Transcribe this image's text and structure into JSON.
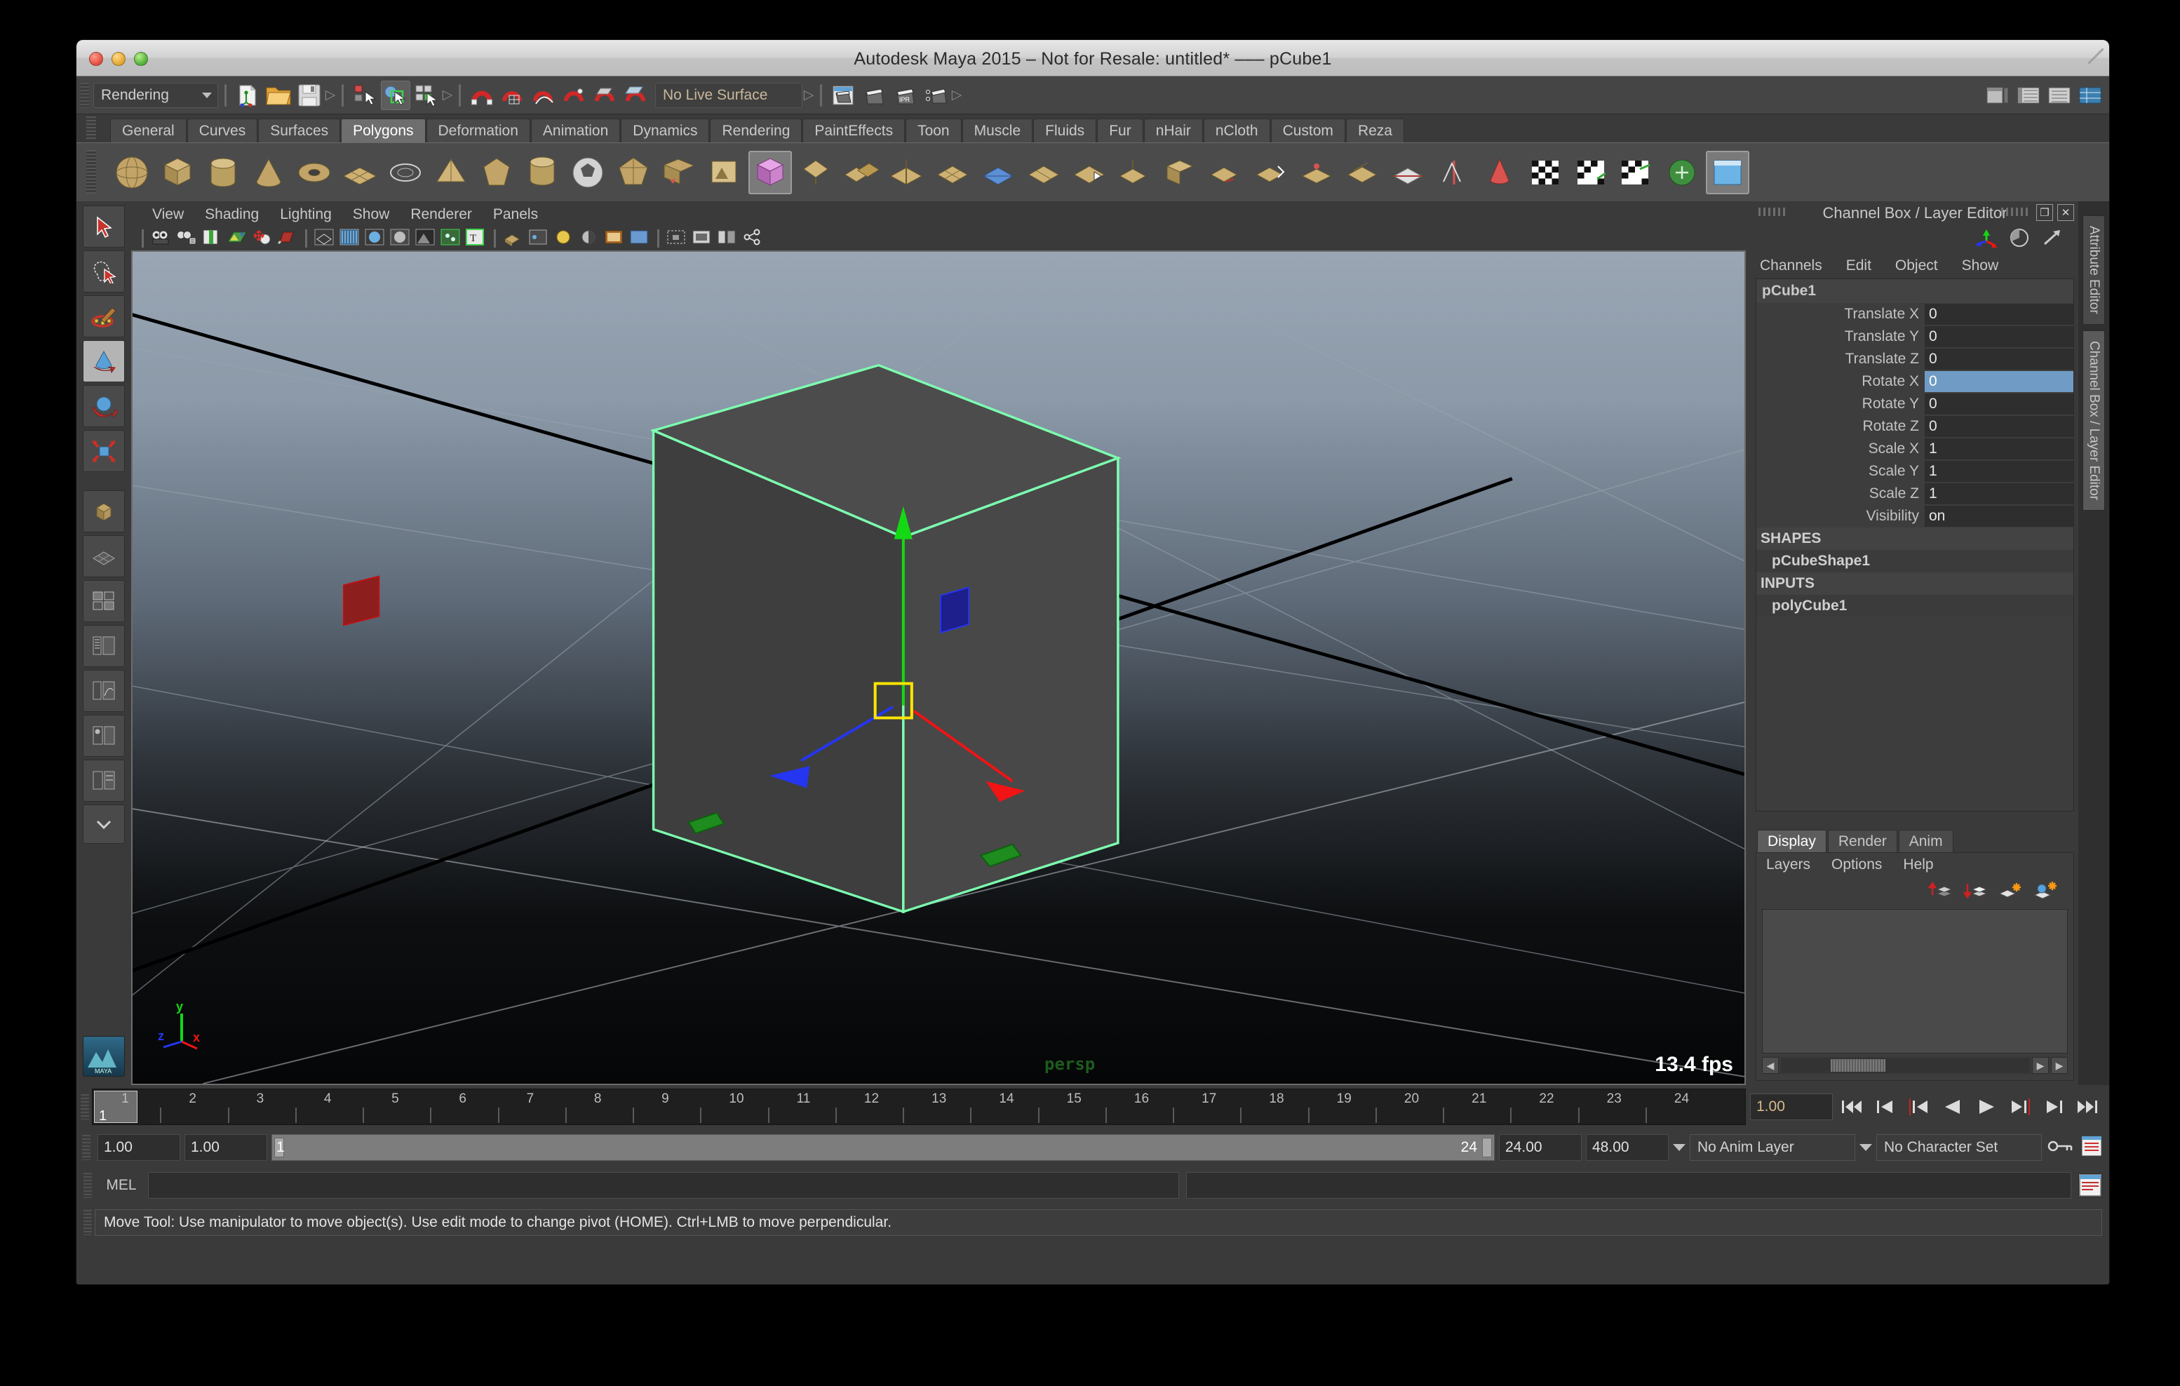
{
  "window": {
    "title": "Autodesk Maya 2015 – Not for Resale: untitled*   –––   pCube1",
    "buttons": {
      "close": "close-button",
      "minimize": "minimize-button",
      "maximize": "maximize-button"
    }
  },
  "statusline": {
    "menu_set": "Rendering",
    "live_surface": "No Live Surface",
    "icons": [
      "new-scene-icon",
      "open-scene-icon",
      "save-scene-icon",
      "select-hierarchy-icon",
      "select-object-icon",
      "select-component-icon",
      "snap-magnet-icon",
      "snap-grid-icon",
      "snap-curve-icon",
      "snap-point-icon",
      "snap-view-plane-icon",
      "construction-plane-icon",
      "render-current-frame-icon",
      "render-sequence-icon",
      "ipr-render-icon",
      "render-settings-icon",
      "show-hide-editors-icon",
      "attribute-editor-toggle-icon",
      "tool-settings-toggle-icon",
      "channel-box-toggle-icon"
    ]
  },
  "shelf": {
    "tabs": [
      "General",
      "Curves",
      "Surfaces",
      "Polygons",
      "Deformation",
      "Animation",
      "Dynamics",
      "Rendering",
      "PaintEffects",
      "Toon",
      "Muscle",
      "Fluids",
      "Fur",
      "nHair",
      "nCloth",
      "Custom",
      "Reza"
    ],
    "selected_tab": "Polygons",
    "items": [
      "polysphere-icon",
      "polycube-icon",
      "polycylinder-icon",
      "polycone-icon",
      "polytorus-icon",
      "polyplane-icon",
      "polydisc-icon",
      "polypyramid-icon",
      "polyprism-icon",
      "polyhelix-icon",
      "poly-soccer-icon",
      "poly-platonic-icon",
      "poly-type-icon",
      "poly-svg-icon",
      "poly-combine-icon",
      "poly-separate-icon",
      "poly-booleans-icon",
      "poly-mirror-icon",
      "poly-smooth-icon",
      "poly-triangulate-icon",
      "poly-quadrangulate-icon",
      "poly-reduce-icon",
      "poly-extrude-icon",
      "poly-bevel-icon",
      "poly-bridge-icon",
      "poly-append-icon",
      "poly-wedge-icon",
      "poly-duplicate-face-icon",
      "poly-connect-icon",
      "poly-split-icon",
      "poly-cone-sculpt-icon",
      "checker-uv-icon",
      "uv-layout-icon",
      "uv-editor-icon",
      "uv-snapshot-icon",
      "uv-create-icon",
      "uv-unfold-icon"
    ]
  },
  "toolbox": {
    "tools": [
      {
        "name": "select-tool",
        "selected": false
      },
      {
        "name": "lasso-select-tool",
        "selected": false
      },
      {
        "name": "paint-select-tool",
        "selected": false
      },
      {
        "name": "move-tool",
        "selected": true
      },
      {
        "name": "rotate-tool",
        "selected": false
      },
      {
        "name": "scale-tool",
        "selected": false
      },
      {
        "name": "last-tool-used",
        "selected": false
      },
      {
        "name": "single-perspective-layout",
        "selected": false
      },
      {
        "name": "four-view-layout",
        "selected": false
      },
      {
        "name": "persp-outliner-layout",
        "selected": false
      },
      {
        "name": "persp-graph-layout",
        "selected": false
      },
      {
        "name": "hypershade-persp-layout",
        "selected": false
      },
      {
        "name": "persp-hypergraph-layout",
        "selected": false
      },
      {
        "name": "more-layouts",
        "selected": false
      }
    ],
    "logo": "maya-logo-icon"
  },
  "viewport": {
    "menus": [
      "View",
      "Shading",
      "Lighting",
      "Show",
      "Renderer",
      "Panels"
    ],
    "toolbar_icons": [
      "select-camera-icon",
      "camera-attributes-icon",
      "toggle-bookmarks-icon",
      "image-plane-icon",
      "grid-toggle-icon",
      "film-gate-icon",
      "resolution-gate-icon",
      "gate-mask-icon",
      "wireframe-icon",
      "smooth-shade-icon",
      "shaded-textured-icon",
      "use-all-lights-icon",
      "shadows-icon",
      "xray-icon",
      "xray-joints-icon",
      "exposure-icon",
      "gamma-icon",
      "isolate-select-icon",
      "display-textures-icon",
      "object-viewport-icon",
      "viewport-snapshot-icon",
      "share-icon"
    ],
    "fps": "13.4 fps",
    "camera_label": "persp",
    "axis_labels": {
      "x": "x",
      "y": "y",
      "z": "z"
    },
    "selected_object_outline": "#7dffb0",
    "manipulator": "move-manipulator"
  },
  "channel_box": {
    "panel_title": "Channel Box / Layer Editor",
    "header_icons": [
      "channel-box-icon",
      "anim-layer-icon",
      "expand-icon"
    ],
    "menus": [
      "Channels",
      "Edit",
      "Object",
      "Show"
    ],
    "node_name": "pCube1",
    "channels": [
      {
        "label": "Translate X",
        "value": "0",
        "highlighted": false
      },
      {
        "label": "Translate Y",
        "value": "0",
        "highlighted": false
      },
      {
        "label": "Translate Z",
        "value": "0",
        "highlighted": false
      },
      {
        "label": "Rotate X",
        "value": "0",
        "highlighted": true
      },
      {
        "label": "Rotate Y",
        "value": "0",
        "highlighted": false
      },
      {
        "label": "Rotate Z",
        "value": "0",
        "highlighted": false
      },
      {
        "label": "Scale X",
        "value": "1",
        "highlighted": false
      },
      {
        "label": "Scale Y",
        "value": "1",
        "highlighted": false
      },
      {
        "label": "Scale Z",
        "value": "1",
        "highlighted": false
      },
      {
        "label": "Visibility",
        "value": "on",
        "highlighted": false
      }
    ],
    "shapes_header": "SHAPES",
    "shape_node": "pCubeShape1",
    "inputs_header": "INPUTS",
    "input_node": "polyCube1",
    "highlight_color": "#6f9bc4"
  },
  "layer_editor": {
    "tabs": [
      "Display",
      "Render",
      "Anim"
    ],
    "selected_tab": "Display",
    "menus": [
      "Layers",
      "Options",
      "Help"
    ],
    "buttons": [
      "move-layer-up-icon",
      "move-layer-down-icon",
      "new-layer-icon",
      "new-layer-from-selected-icon"
    ]
  },
  "right_tabs": [
    {
      "label": "Attribute Editor",
      "selected": false
    },
    {
      "label": "Channel Box / Layer Editor",
      "selected": true
    }
  ],
  "timeline": {
    "ticks": [
      "1",
      "2",
      "3",
      "4",
      "5",
      "6",
      "7",
      "8",
      "9",
      "10",
      "11",
      "12",
      "13",
      "14",
      "15",
      "16",
      "17",
      "18",
      "19",
      "20",
      "21",
      "22",
      "23",
      "24"
    ],
    "current_frame": "1",
    "current_frame_field": "1.00",
    "playback_buttons": [
      "go-to-start-icon",
      "step-back-frame-icon",
      "step-back-key-icon",
      "play-backwards-icon",
      "play-forwards-icon",
      "step-forward-key-icon",
      "step-forward-frame-icon",
      "go-to-end-icon"
    ]
  },
  "range_slider": {
    "anim_start": "1.00",
    "range_start": "1.00",
    "bar_start": "1",
    "bar_end": "24",
    "range_end": "24.00",
    "anim_end": "48.00",
    "anim_layer": "No Anim Layer",
    "character_set": "No Character Set",
    "icons": [
      "auto-key-icon",
      "animation-preferences-icon"
    ]
  },
  "command_line": {
    "label": "MEL",
    "input_value": "",
    "output_value": "",
    "script_editor_icon": "script-editor-icon"
  },
  "help_line": {
    "message": "Move Tool: Use manipulator to move object(s). Use edit mode to change pivot (HOME).  Ctrl+LMB to move perpendicular."
  }
}
